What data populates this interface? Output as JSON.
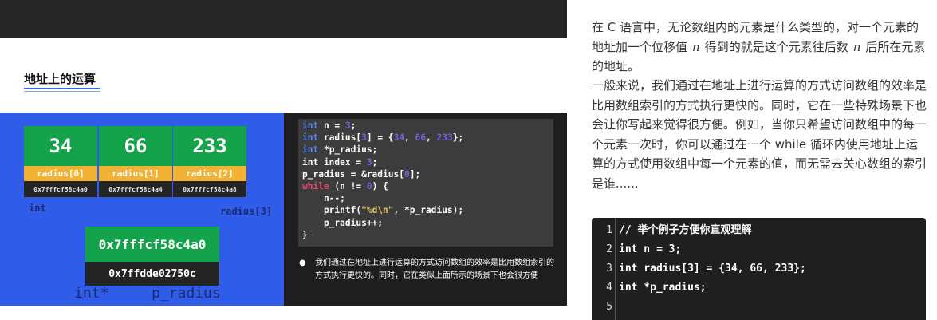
{
  "slide": {
    "title": "地址上的运算",
    "array_cells": [
      {
        "value": "34",
        "label": "radius[0]",
        "address": "0x7fffcf58c4a0"
      },
      {
        "value": "66",
        "label": "radius[1]",
        "address": "0x7fffcf58c4a4"
      },
      {
        "value": "233",
        "label": "radius[2]",
        "address": "0x7fffcf58c4a8"
      }
    ],
    "element_type": "int",
    "array_end_label": "radius[3]",
    "pointer": {
      "value": "0x7fffcf58c4a0",
      "address": "0x7ffdde02750c",
      "type": "int*",
      "name": "p_radius"
    },
    "code": {
      "l1": {
        "kw": "int",
        "rest": " n = ",
        "num": "3",
        "end": ";"
      },
      "l2": {
        "kw": "int",
        "a": " radius[",
        "n0": "3",
        "b": "] = {",
        "n1": "34",
        "c": ", ",
        "n2": "66",
        "d": ", ",
        "n3": "233",
        "e": "};"
      },
      "l3": {
        "kw": "int",
        "rest": " *p_radius;"
      },
      "l4": {
        "a": "int index = ",
        "num": "3",
        "end": ";"
      },
      "l5": {
        "a": "p_radius = &radius[",
        "num": "0",
        "end": "];"
      },
      "l6": {
        "kw": "while",
        "a": " (n != ",
        "num": "0",
        "end": ") {"
      },
      "l7": "    n--;",
      "l8": {
        "a": "    printf(",
        "str": "\"%d\\n\"",
        "end": ", *p_radius);"
      },
      "l9": "    p_radius++;",
      "l10": "}"
    },
    "bullet": "我们通过在地址上进行运算的方式访问数组的效率是比用数组索引的方式执行更快的。同时，它在类似上面所示的场景下也会很方便"
  },
  "article": {
    "p1_a": "在 C 语言中，无论数组内的元素是什么类型的，对一个元素的地址加一个位移值",
    "p1_var1": "n",
    "p1_b": "得到的就是这个元素往后数",
    "p1_var2": "n",
    "p1_c": "后所在元素的地址。",
    "p2": "一般来说，我们通过在地址上进行运算的方式访问数组的效率是比用数组索引的方式执行更快的。同时，它在一些特殊场景下也会让你写起来觉得很方便。例如，当你只希望访问数组中的每一个元素一次时，你可以通过在一个 while 循环内使用地址上运算的方式使用数组中每一个元素的值，而无需去关心数组的索引是谁......",
    "code_lines": [
      {
        "num": "1",
        "text": "// 举个例子方便你直观理解"
      },
      {
        "num": "2",
        "text": "int n = 3;"
      },
      {
        "num": "3",
        "text": "int radius[3] = {34, 66, 233};"
      },
      {
        "num": "4",
        "text": "int *p_radius;"
      },
      {
        "num": "5",
        "text": ""
      }
    ]
  }
}
